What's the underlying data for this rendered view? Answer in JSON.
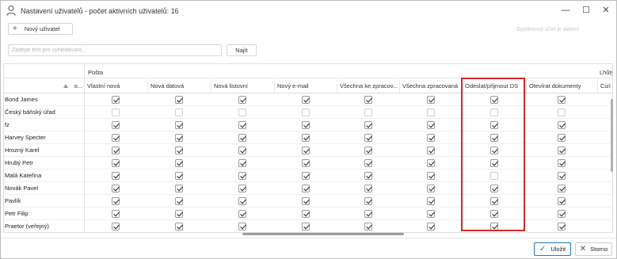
{
  "window": {
    "title": "Nastavení uživatelů - počet aktivních uživatelů: 16",
    "controls": {
      "minimize": "—",
      "maximize": "☐",
      "close": "✕"
    }
  },
  "toolbar": {
    "add_user_label": "Nový uživatel",
    "add_icon": "+",
    "system_account_note": "Systémový účet je aktivní"
  },
  "search": {
    "placeholder": "Zadejte text pro vyhledávání...",
    "value": "",
    "button_label": "Najít"
  },
  "grid": {
    "column_groups": [
      "Pošta",
      "Lhůty a"
    ],
    "name_header_truncated": "o...",
    "columns": [
      "Vlastní nová",
      "Nová datová",
      "Nová listovní",
      "Nový e-mail",
      "Všechna ke zpracov...",
      "Všechna zpracovaná",
      "Odeslat/přijmout DS",
      "Otevírat dokumenty",
      "Cizí po"
    ],
    "rows": [
      {
        "name": "Bond James",
        "values": [
          true,
          true,
          true,
          true,
          true,
          true,
          true,
          true
        ]
      },
      {
        "name": "Český báňský úřad",
        "values": [
          false,
          false,
          false,
          false,
          false,
          false,
          false,
          false
        ]
      },
      {
        "name": "fz",
        "values": [
          true,
          true,
          true,
          true,
          true,
          true,
          true,
          true
        ]
      },
      {
        "name": "Harvey Specter",
        "values": [
          true,
          true,
          true,
          true,
          true,
          true,
          true,
          true
        ]
      },
      {
        "name": "Hrozný Karel",
        "values": [
          true,
          true,
          true,
          true,
          true,
          true,
          true,
          true
        ]
      },
      {
        "name": "Hrubý Petr",
        "values": [
          true,
          true,
          true,
          true,
          true,
          true,
          true,
          true
        ]
      },
      {
        "name": "Malá Kateřina",
        "values": [
          true,
          true,
          true,
          true,
          true,
          true,
          false,
          true
        ]
      },
      {
        "name": "Novák Pavel",
        "values": [
          true,
          true,
          true,
          true,
          true,
          true,
          true,
          true
        ]
      },
      {
        "name": "Pavlík",
        "values": [
          true,
          true,
          true,
          true,
          true,
          true,
          true,
          true
        ]
      },
      {
        "name": "Petr Filip",
        "values": [
          true,
          true,
          true,
          true,
          true,
          true,
          true,
          true
        ]
      },
      {
        "name": "Praetor (veřejný)",
        "values": [
          true,
          true,
          true,
          true,
          true,
          true,
          true,
          true
        ]
      }
    ]
  },
  "footer": {
    "save_label": "Uložit",
    "cancel_label": "Storno",
    "save_icon": "✓",
    "cancel_icon": "✕"
  },
  "colors": {
    "highlight": "#d22a2a",
    "accent": "#1f7ab8"
  }
}
